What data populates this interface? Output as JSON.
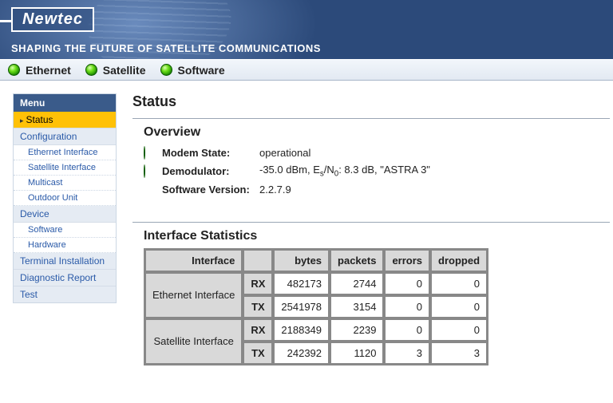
{
  "brand": {
    "logo": "Newtec",
    "tagline": "SHAPING THE FUTURE OF SATELLITE COMMUNICATIONS"
  },
  "topnav": [
    {
      "label": "Ethernet"
    },
    {
      "label": "Satellite"
    },
    {
      "label": "Software"
    }
  ],
  "sidebar": {
    "title": "Menu",
    "status": "Status",
    "config": "Configuration",
    "config_items": [
      "Ethernet Interface",
      "Satellite Interface",
      "Multicast",
      "Outdoor Unit"
    ],
    "device": "Device",
    "device_items": [
      "Software",
      "Hardware"
    ],
    "terminal": "Terminal Installation",
    "diagnostic": "Diagnostic Report",
    "test": "Test"
  },
  "page": {
    "title": "Status"
  },
  "overview": {
    "heading": "Overview",
    "modem_label": "Modem State:",
    "modem_value": "operational",
    "demod_label": "Demodulator:",
    "demod_prefix": "-35.0 dBm, E",
    "demod_s": "s",
    "demod_mid": "/N",
    "demod_0": "0",
    "demod_suffix": ": 8.3 dB, \"ASTRA 3\"",
    "sw_label": "Software Version:",
    "sw_value": "2.2.7.9"
  },
  "stats": {
    "heading": "Interface Statistics",
    "headers": {
      "interface": "Interface",
      "bytes": "bytes",
      "packets": "packets",
      "errors": "errors",
      "dropped": "dropped"
    },
    "rows": [
      {
        "name": "Ethernet Interface",
        "rx": {
          "dir": "RX",
          "bytes": "482173",
          "packets": "2744",
          "errors": "0",
          "dropped": "0"
        },
        "tx": {
          "dir": "TX",
          "bytes": "2541978",
          "packets": "3154",
          "errors": "0",
          "dropped": "0"
        }
      },
      {
        "name": "Satellite Interface",
        "rx": {
          "dir": "RX",
          "bytes": "2188349",
          "packets": "2239",
          "errors": "0",
          "dropped": "0"
        },
        "tx": {
          "dir": "TX",
          "bytes": "242392",
          "packets": "1120",
          "errors": "3",
          "dropped": "3"
        }
      }
    ]
  }
}
